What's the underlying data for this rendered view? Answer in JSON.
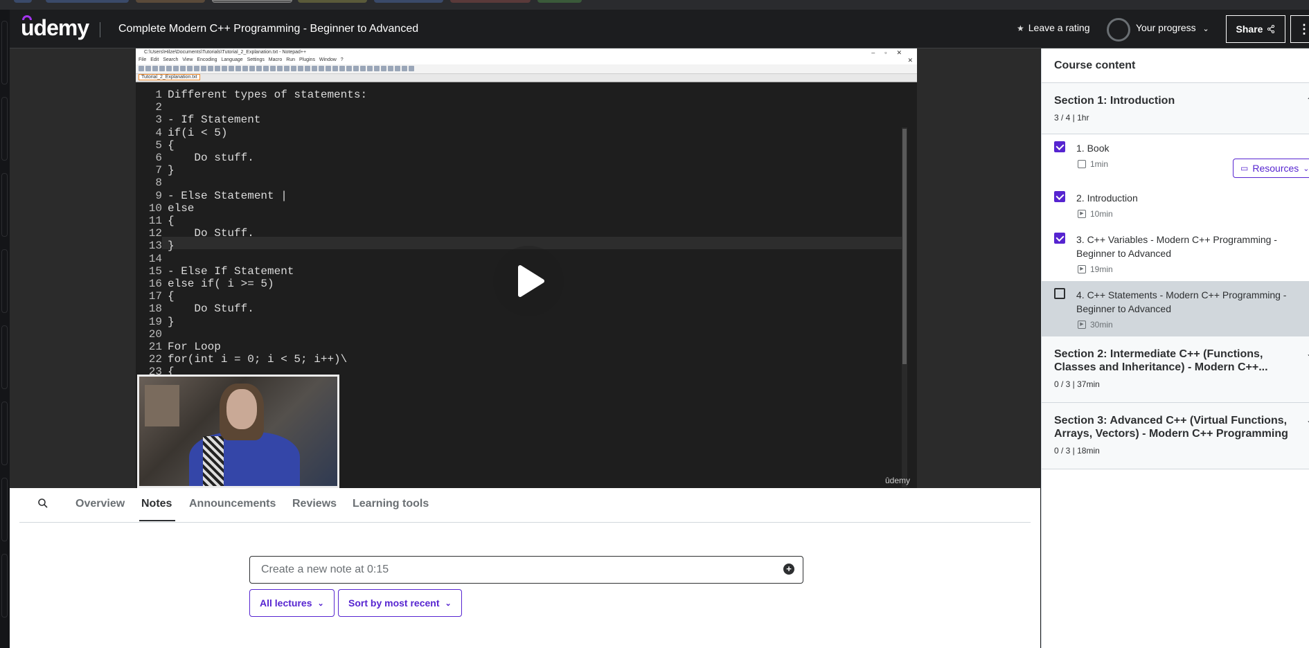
{
  "header": {
    "logo": "udemy",
    "course_title": "Complete Modern C++ Programming - Beginner to Advanced",
    "rating_label": "Leave a rating",
    "progress_label": "Your progress",
    "share_label": "Share",
    "more_label": "⋮"
  },
  "video": {
    "window_title": "C:\\Users\\Hilze\\Documents\\Tutorials\\Tutorial_2_Explanation.txt - Notepad++",
    "menu": "File Edit Search View Encoding Language Settings Macro Run Plugins Window ?",
    "tab_name": "Tutorial_2_Explanation.txt",
    "line_numbers": "1\n2\n3\n4\n5\n6\n7\n8\n9\n10\n11\n12\n13\n14\n15\n16\n17\n18\n19\n20\n21\n22\n23",
    "code": "Different types of statements:\n\n- If Statement\nif(i < 5)\n{\n    Do stuff.\n}\n\n- Else Statement |\nelse\n{\n    Do Stuff.\n}\n\n- Else If Statement\nelse if( i >= 5)\n{\n    Do Stuff.\n}\n\nFor Loop\nfor(int i = 0; i < 5; i++)\\\n{",
    "watermark": "ûdemy"
  },
  "tabs": [
    "Overview",
    "Notes",
    "Announcements",
    "Reviews",
    "Learning tools"
  ],
  "active_tab": "Notes",
  "notes": {
    "placeholder": "Create a new note at 0:15",
    "filter_lectures": "All lectures",
    "sort": "Sort by most recent"
  },
  "sidebar": {
    "heading": "Course content",
    "sections": [
      {
        "title": "Section 1: Introduction",
        "meta": "3 / 4 | 1hr",
        "lectures": [
          {
            "title": "1. Book",
            "duration": "1min",
            "completed": true,
            "type": "document-icon",
            "resources": "Resources"
          },
          {
            "title": "2. Introduction",
            "duration": "10min",
            "completed": true,
            "type": "video-icon"
          },
          {
            "title": "3. C++ Variables - Modern C++ Programming - Beginner to Advanced",
            "duration": "19min",
            "completed": true,
            "type": "video-icon"
          },
          {
            "title": "4. C++ Statements - Modern C++ Programming - Beginner to Advanced",
            "duration": "30min",
            "completed": false,
            "type": "video-icon",
            "active": true
          }
        ]
      },
      {
        "title": "Section 2: Intermediate C++ (Functions, Classes and Inheritance) - Modern C++...",
        "meta": "0 / 3 | 37min"
      },
      {
        "title": "Section 3: Advanced C++ (Virtual Functions, Arrays, Vectors) - Modern C++ Programming",
        "meta": "0 / 3 | 18min"
      }
    ]
  },
  "colors": {
    "accent": "#5624d0",
    "dark": "#1c1d1f",
    "logo_accent": "#a435f0"
  }
}
